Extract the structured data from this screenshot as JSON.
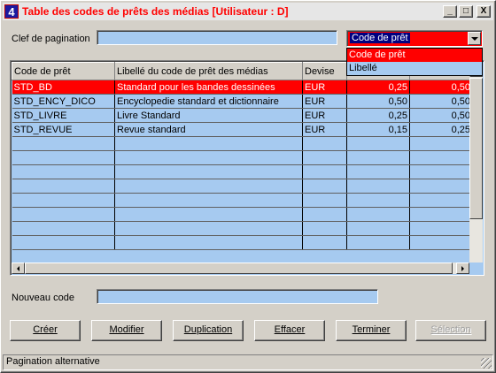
{
  "window": {
    "title": "Table des codes de prêts des médias [Utilisateur : D]",
    "app_icon": "4",
    "minimize_label": "_",
    "maximize_label": "□",
    "close_label": "X"
  },
  "pagination": {
    "label": "Clef de pagination",
    "value": ""
  },
  "sort_combo": {
    "selected": "Code de prêt",
    "options": [
      "Code de prêt",
      "Libellé"
    ]
  },
  "grid": {
    "columns": [
      "Code de prêt",
      "Libellé du code de prêt des médias",
      "Devise",
      "",
      ""
    ],
    "rows": [
      [
        "STD_BD",
        "Standard pour les bandes dessinées",
        "EUR",
        "0,25",
        "0,50"
      ],
      [
        "STD_ENCY_DICO",
        "Encyclopedie standard et dictionnaire",
        "EUR",
        "0,50",
        "0,50"
      ],
      [
        "STD_LIVRE",
        "Livre Standard",
        "EUR",
        "0,25",
        "0,50"
      ],
      [
        "STD_REVUE",
        "Revue standard",
        "EUR",
        "0,15",
        "0,25"
      ]
    ],
    "selected_row": 0
  },
  "new_code": {
    "label": "Nouveau code",
    "value": ""
  },
  "buttons": {
    "create": "Créer",
    "modify": "Modifier",
    "duplicate": "Duplication",
    "delete": "Effacer",
    "finish": "Terminer",
    "select": "Sélection"
  },
  "status": {
    "text": "Pagination alternative"
  },
  "colors": {
    "accent_selection": "#ff0000",
    "field_background": "#a6caf0",
    "title_text": "#ff0000",
    "face": "#d4d0c8"
  }
}
